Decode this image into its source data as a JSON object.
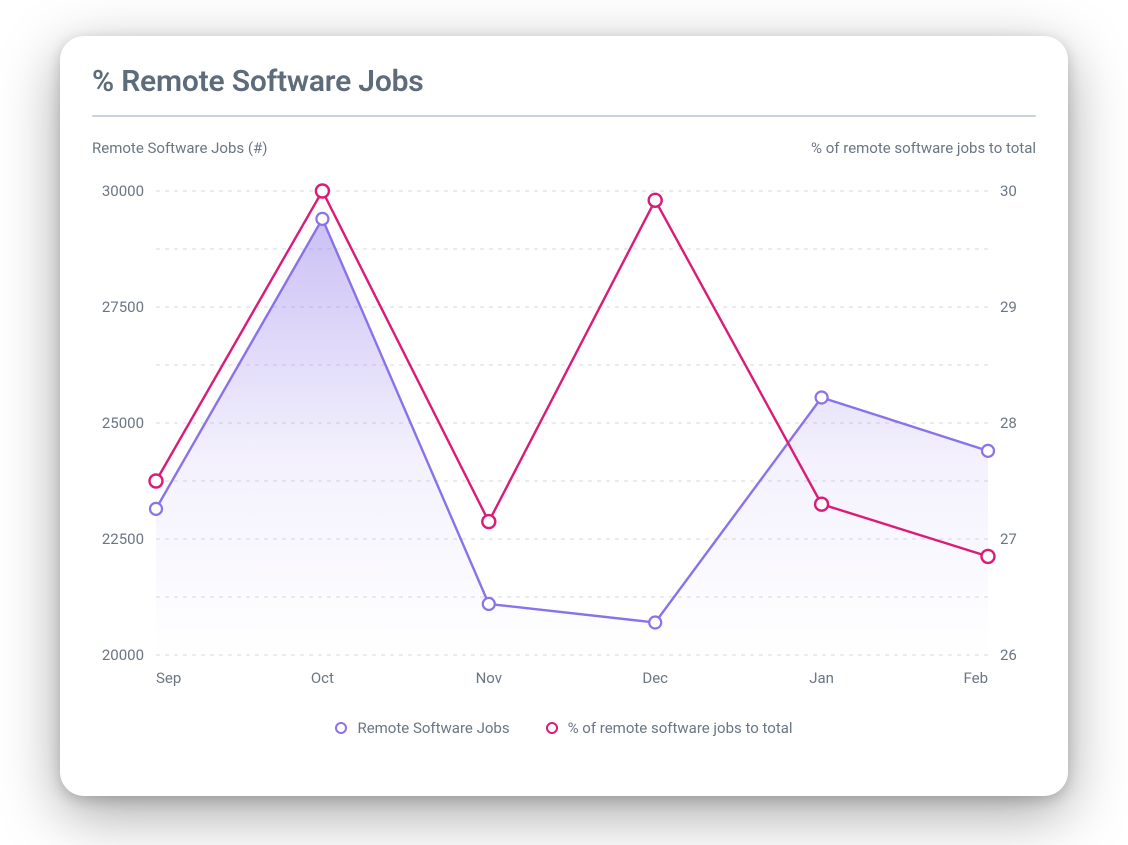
{
  "title": "% Remote Software Jobs",
  "axis": {
    "left_label": "Remote Software Jobs (#)",
    "right_label": "% of remote software jobs to total"
  },
  "legend": {
    "a": "Remote Software Jobs",
    "b": "% of remote software jobs to total"
  },
  "chart_data": {
    "type": "line",
    "categories": [
      "Sep",
      "Oct",
      "Nov",
      "Dec",
      "Jan",
      "Feb"
    ],
    "series": [
      {
        "name": "Remote Software Jobs",
        "axis": "left",
        "style": "area",
        "values": [
          23150,
          29400,
          21100,
          20700,
          25550,
          24400
        ]
      },
      {
        "name": "% of remote software jobs to total",
        "axis": "right",
        "style": "line",
        "values": [
          27.5,
          30.0,
          27.15,
          29.92,
          27.3,
          26.85
        ]
      }
    ],
    "y_left": {
      "min": 20000,
      "max": 30000,
      "ticks": [
        20000,
        22500,
        25000,
        27500,
        30000
      ]
    },
    "y_right": {
      "min": 26,
      "max": 30,
      "ticks": [
        26,
        27,
        28,
        29,
        30
      ]
    },
    "grid": true
  },
  "colors": {
    "series_a": "#8a72e8",
    "series_b": "#da1c78",
    "text": "#6b7684",
    "rule": "#c8d2dc"
  }
}
